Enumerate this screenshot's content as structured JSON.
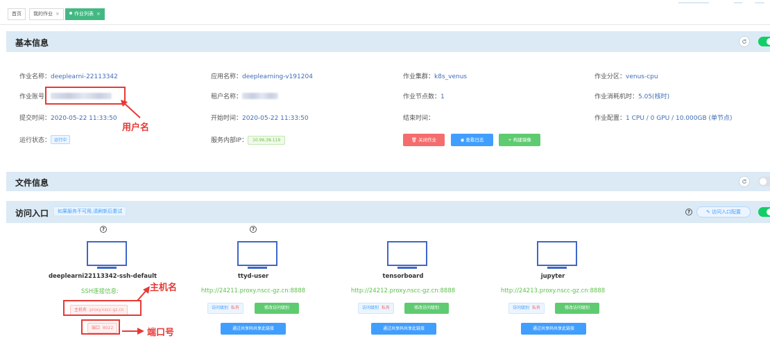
{
  "tabs": [
    {
      "label": "首页",
      "closable": false,
      "active": false
    },
    {
      "label": "我的作业",
      "closable": true,
      "active": false
    },
    {
      "label": "作业列表",
      "closable": true,
      "active": true
    }
  ],
  "close_glyph": "×",
  "basic": {
    "title": "基本信息",
    "refresh_icon": "refresh-icon",
    "toggle_on": true,
    "fields": {
      "job_name_label": "作业名称：",
      "job_name": "deeplearni-22113342",
      "app_name_label": "应用名称：",
      "app_name": "deeplearning-v191204",
      "cluster_label": "作业集群：",
      "cluster": "k8s_venus",
      "partition_label": "作业分区：",
      "partition": "venus-cpu",
      "account_label": "作业账号：",
      "tenant_label": "租户名称：",
      "nodes_label": "作业节点数：",
      "nodes": "1",
      "core_hours_label": "作业消耗机时：",
      "core_hours": "5.05(核时)",
      "submit_label": "提交时间：",
      "submit_time": "2020-05-22 11:33:50",
      "start_label": "开始时间：",
      "start_time": "2020-05-22 11:33:50",
      "end_label": "结束时间：",
      "config_label": "作业配置：",
      "config": "1 CPU / 0 GPU / 10.000GB (单节点)",
      "status_label": "运行状态：",
      "status": "运行中",
      "ip_label": "服务内部IP：",
      "ip": "10.96.38.119"
    },
    "actions": {
      "close_job": "关闭作业",
      "view_log": "查看日志",
      "build_image": "构建镜像"
    },
    "annotation": "用户名"
  },
  "files": {
    "title": "文件信息",
    "toggle_on": false
  },
  "access": {
    "title": "访问入口",
    "note": "如果服务不可用,请刷新后重试",
    "config_button": "访问入口配置",
    "toggle_on": true,
    "services": [
      {
        "name": "deeplearni22113342-ssh-default",
        "help": true,
        "url": ""
      },
      {
        "name": "ttyd-user",
        "help": true,
        "url": "http://24211.proxy.nscc-gz.cn:8888"
      },
      {
        "name": "tensorboard",
        "help": false,
        "url": "http://24212.proxy.nscc-gz.cn:8888"
      },
      {
        "name": "jupyter",
        "help": false,
        "url": "http://24213.proxy.nscc-gz.cn:8888"
      }
    ],
    "level_label": "访问级别",
    "level_value": "私有",
    "change_level": "修改访问级别",
    "share_button": "通过共享码共享此链接",
    "ssh_info_title": "SSH连接信息:",
    "ssh_host_label": "主机名",
    "ssh_host": "proxy.nscc-gz.cn",
    "ssh_port_label": "端口",
    "ssh_port": "8022",
    "annotation_host": "主机名",
    "annotation_port": "端口号"
  },
  "colors": {
    "panel_header": "#dbeaf5",
    "link_blue": "#3f6db5",
    "accent_green": "#13ce66",
    "danger_red": "#f56c6c",
    "primary_blue": "#409eff",
    "annotation_red": "#e53935"
  }
}
